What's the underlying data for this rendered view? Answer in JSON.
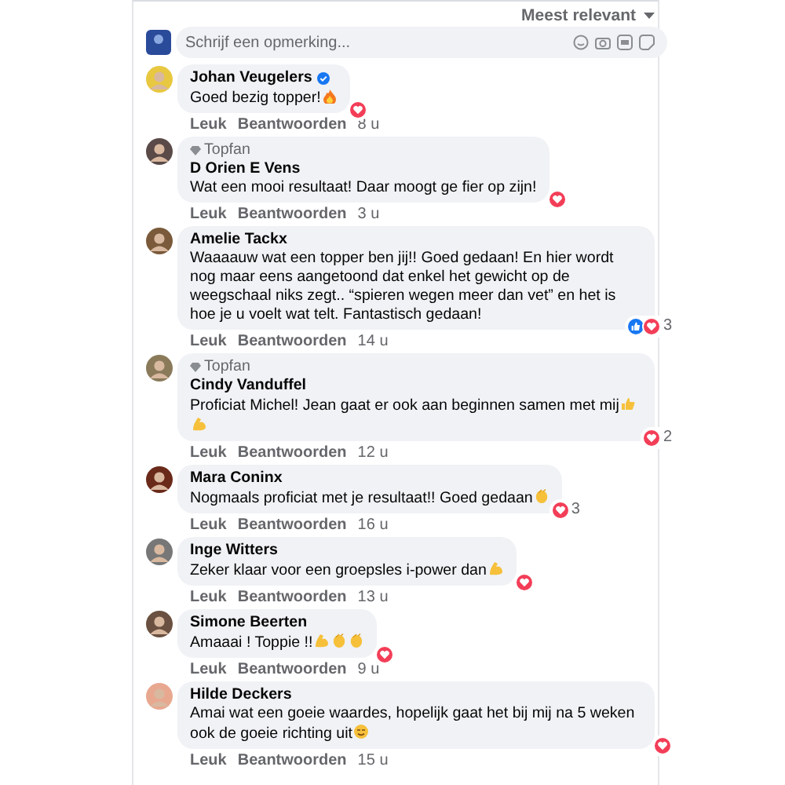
{
  "sort": {
    "label": "Meest relevant"
  },
  "composer": {
    "placeholder": "Schrijf een opmerking..."
  },
  "comments": [
    {
      "author": "Johan Veugelers",
      "verified": true,
      "text": "Goed bezig topper!",
      "emoji": [
        {
          "kind": "fire"
        }
      ],
      "reactions": {
        "types": [
          {
            "kind": "love"
          }
        ]
      },
      "actions": [
        "Leuk",
        "Beantwoorden"
      ],
      "time": "8 u"
    },
    {
      "author": "D Orien E Vens",
      "verified": false,
      "topfan": "Topfan",
      "text": "Wat een mooi resultaat! Daar moogt ge fier op zijn!",
      "reactions": {
        "types": [
          {
            "kind": "love"
          }
        ]
      },
      "actions": [
        "Leuk",
        "Beantwoorden"
      ],
      "time": "3 u"
    },
    {
      "author": "Amelie Tackx",
      "verified": false,
      "text": "Waaaauw wat een topper ben jij!! Goed gedaan! En hier wordt nog maar eens aangetoond dat enkel het gewicht op de weegschaal niks zegt.. “spieren wegen meer dan vet” en het is hoe je u voelt wat telt. Fantastisch gedaan!",
      "reactions": {
        "types": [
          {
            "kind": "like"
          },
          {
            "kind": "love"
          }
        ],
        "count": "3"
      },
      "actions": [
        "Leuk",
        "Beantwoorden"
      ],
      "time": "14 u"
    },
    {
      "author": "Cindy Vanduffel",
      "verified": false,
      "topfan": "Topfan",
      "text": "Proficiat Michel! Jean gaat er ook aan beginnen samen met mij",
      "emoji": [
        {
          "kind": "thumb"
        },
        {
          "kind": "muscle"
        }
      ],
      "reactions": {
        "types": [
          {
            "kind": "love"
          }
        ],
        "count": "2"
      },
      "actions": [
        "Leuk",
        "Beantwoorden"
      ],
      "time": "12 u"
    },
    {
      "author": "Mara Coninx",
      "verified": false,
      "text": "Nogmaals proficiat met je resultaat!! Goed gedaan",
      "emoji": [
        {
          "kind": "clap"
        }
      ],
      "reactions": {
        "types": [
          {
            "kind": "love"
          }
        ],
        "count": "3"
      },
      "actions": [
        "Leuk",
        "Beantwoorden"
      ],
      "time": "16 u"
    },
    {
      "author": "Inge Witters",
      "verified": false,
      "text": "Zeker klaar voor een groepsles i-power dan",
      "emoji": [
        {
          "kind": "muscle"
        }
      ],
      "reactions": {
        "types": [
          {
            "kind": "love"
          }
        ]
      },
      "actions": [
        "Leuk",
        "Beantwoorden"
      ],
      "time": "13 u"
    },
    {
      "author": "Simone Beerten",
      "verified": false,
      "text": "Amaaai ! Toppie !!",
      "emoji": [
        {
          "kind": "muscle"
        },
        {
          "kind": "clap"
        },
        {
          "kind": "clap"
        }
      ],
      "reactions": {
        "types": [
          {
            "kind": "love"
          }
        ]
      },
      "actions": [
        "Leuk",
        "Beantwoorden"
      ],
      "time": "9 u"
    },
    {
      "author": "Hilde Deckers",
      "verified": false,
      "text": "Amai wat een goeie waardes, hopelijk gaat het bij mij na 5 weken ook de goeie richting uit",
      "emoji": [
        {
          "kind": "smile"
        }
      ],
      "reactions": {
        "types": [
          {
            "kind": "love"
          }
        ]
      },
      "actions": [
        "Leuk",
        "Beantwoorden"
      ],
      "time": "15 u"
    }
  ]
}
